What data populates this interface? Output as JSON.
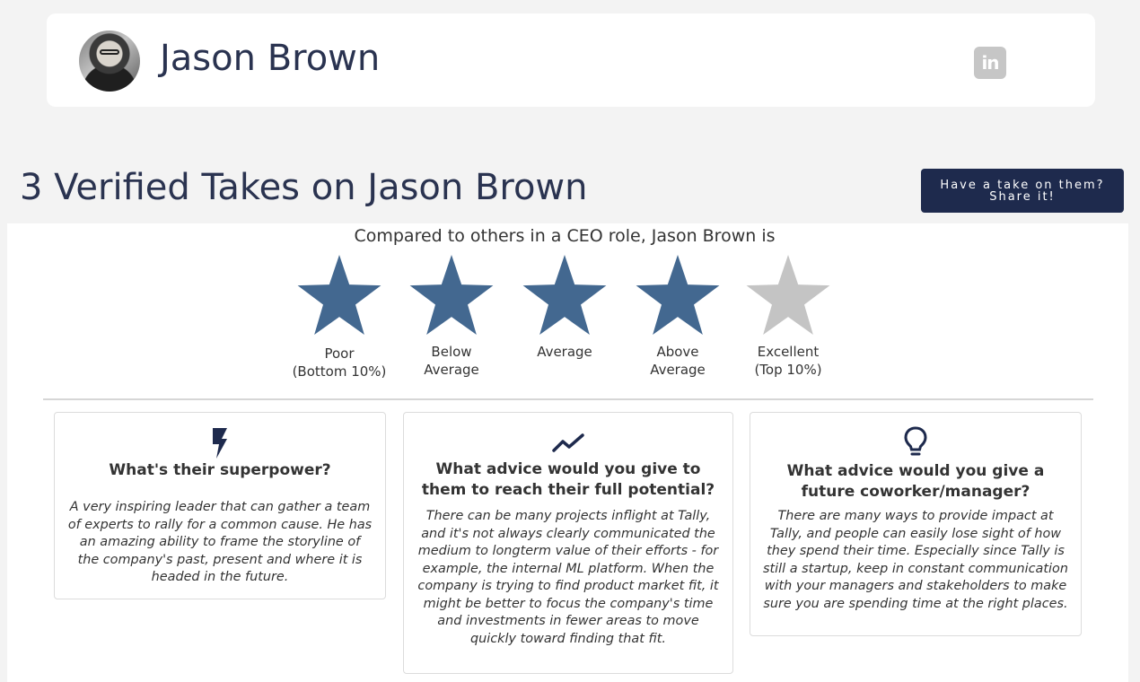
{
  "profile": {
    "name": "Jason Brown",
    "linkedin_icon": "linkedin-icon",
    "linkedin_glyph": "in"
  },
  "takes": {
    "title": "3 Verified Takes on Jason Brown",
    "share_button": "Have a take on them? Share it!"
  },
  "rating": {
    "heading": "Compared to others in a CEO role, Jason Brown is",
    "filled_stars": 4,
    "total_stars": 5,
    "colors": {
      "filled": "#436890",
      "empty": "#c4c4c4"
    },
    "labels": [
      [
        "Poor",
        "(Bottom 10%)"
      ],
      [
        "Below",
        "Average"
      ],
      [
        "Average"
      ],
      [
        "Above",
        "Average"
      ],
      [
        "Excellent",
        "(Top 10%)"
      ]
    ]
  },
  "questions": [
    {
      "icon": "lightning-bolt-icon",
      "title": "What's their superpower?",
      "answer": "A very inspiring leader that can gather a team of experts to rally for a common cause. He has an amazing ability to frame the storyline of the company's past, present and where it is headed in the future."
    },
    {
      "icon": "trending-up-icon",
      "title": "What advice would you give to them to reach their full potential?",
      "answer": "There can be many projects inflight at Tally, and it's not always clearly communicated the medium to longterm value of their efforts - for example, the internal ML platform. When the company is trying to find product market fit, it might be better to focus the company's time and investments in fewer areas to move quickly toward finding that fit."
    },
    {
      "icon": "lightbulb-icon",
      "title": "What advice would you give a future coworker/manager?",
      "answer": "There are many ways to provide impact at Tally, and people can easily lose sight of how they spend their time. Especially since Tally is still a startup, keep in constant communication with your managers and stakeholders to make sure you are spending time at the right places."
    }
  ],
  "colors": {
    "brand_navy": "#1e2a4d",
    "text_navy": "#2a3350"
  }
}
